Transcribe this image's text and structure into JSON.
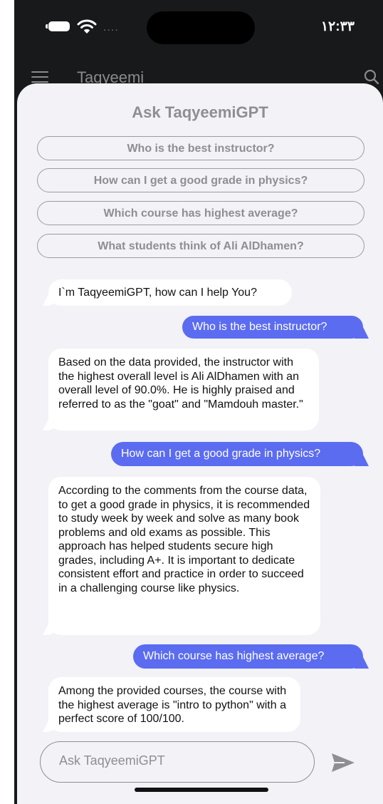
{
  "status_bar": {
    "time": "١٢:٣٣",
    "signal_dots": "...."
  },
  "app_bar": {
    "title": "Taqyeemi"
  },
  "chat": {
    "title": "Ask TaqyeemiGPT",
    "suggestions": [
      "Who is the best instructor?",
      "How can I get a good grade in physics?",
      "Which course has highest average?",
      "What students think of Ali AlDhamen?"
    ],
    "messages": [
      {
        "role": "bot",
        "text": "I`m TaqyeemiGPT, how can I help You?"
      },
      {
        "role": "user",
        "text": "Who is the best instructor?"
      },
      {
        "role": "bot",
        "text": "Based on the data provided, the instructor with the highest overall level is Ali AlDhamen with an overall level of 90.0%. He is highly praised and referred to as the \"goat\" and \"Mamdouh master.\""
      },
      {
        "role": "user",
        "text": "How can I get a good grade in physics?"
      },
      {
        "role": "bot",
        "text": "According to the comments from the course data, to get a good grade in physics, it is recommended to study week by week and solve as many book problems and old exams as possible. This approach has helped students secure high grades, including A+. It is important to dedicate consistent effort and practice in order to succeed in a challenging course like physics."
      },
      {
        "role": "user",
        "text": "Which course has highest average?"
      },
      {
        "role": "bot",
        "text": "Among the provided courses, the course with the highest average is \"intro to python\" with a perfect score of 100/100."
      }
    ],
    "input": {
      "placeholder": "Ask TaqyeemiGPT",
      "value": ""
    }
  },
  "colors": {
    "user_bubble": "#5b6cf0",
    "bot_bubble": "#ffffff",
    "sheet_background": "#f2f2f7",
    "header_background": "#18191b"
  }
}
